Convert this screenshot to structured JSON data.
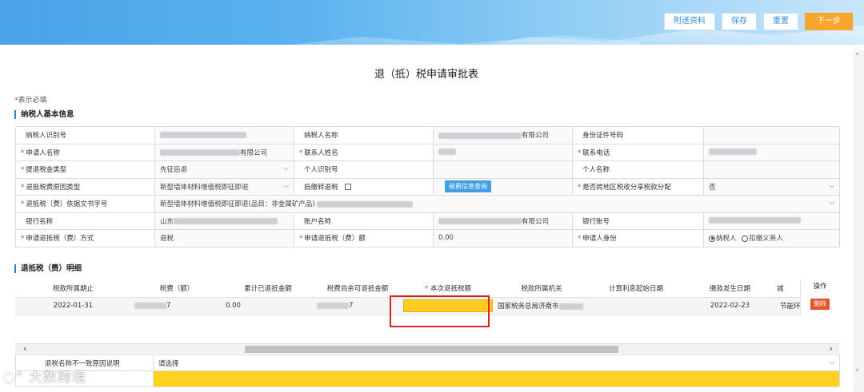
{
  "toolbar": {
    "attach_label": "附送资料",
    "save_label": "保存",
    "reset_label": "重置",
    "next_label": "下一步"
  },
  "page_title": "退（抵）税申请审批表",
  "required_note": {
    "star": "*",
    "text": "表示必填"
  },
  "sections": {
    "taxpayer_info": "纳税人基本信息",
    "detail": "退抵税（费）明细"
  },
  "info": {
    "taxpayer_id_label": "纳税人识别号",
    "taxpayer_name_label": "纳税人名称",
    "taxpayer_name_suffix": "有限公司",
    "id_doc_no_label": "身份证件号码",
    "applicant_name_label": "申请人名称",
    "applicant_name_suffix": "有限公司",
    "contact_name_label": "联系人姓名",
    "contact_phone_label": "联系电话",
    "refund_type_label": "提退税金类型",
    "refund_type_value": "先征后退",
    "personal_id_label": "个人识别号",
    "personal_name_label": "个人名称",
    "reason_type_label": "退抵税费原因类型",
    "reason_type_value": "新型墙体材料增值税即征即退",
    "offset_label": "抵缴转退税",
    "query_btn": "税费信息查询",
    "cross_region_label": "是否跨地区税收分享税款分配",
    "cross_region_value": "否",
    "basis_doc_label": "退抵税（费）依据文书字号",
    "basis_doc_value": "新型墙体材料增值税即征即退(品目：非金属矿产品)",
    "bank_name_label": "银行名称",
    "bank_name_prefix": "山东",
    "account_name_label": "账户名称",
    "account_name_suffix": "有限公司",
    "bank_account_label": "银行账号",
    "method_label": "申请退抵税（费）方式",
    "method_value": "退税",
    "amount_label": "申请退抵税（费）额",
    "amount_value": "0.00",
    "identity_label": "申请人身份",
    "identity_option1": "纳税人",
    "identity_option2": "扣缴义务人"
  },
  "detail_table": {
    "headers": [
      "税款所属期止",
      "税费（额）",
      "累计已退抵金额",
      "税费尚余可退抵金额",
      "本次退抵税额",
      "税款所属机关",
      "计算利息起始日期",
      "缴款发生日期",
      "减"
    ],
    "row": {
      "period_end": "2022-01-31",
      "tax_amount_suffix": "7",
      "refunded_total": "0.00",
      "remaining_suffix": "7",
      "tax_authority": "国家税务总局济南市",
      "payment_date": "2022-02-23",
      "reduction": "节能环保"
    },
    "op_header": "操作",
    "delete_label": "删除"
  },
  "reason_rows": {
    "mismatch_label": "退税名称不一致原因说明",
    "mismatch_value": "请选择"
  },
  "watermark": "大数跨境"
}
